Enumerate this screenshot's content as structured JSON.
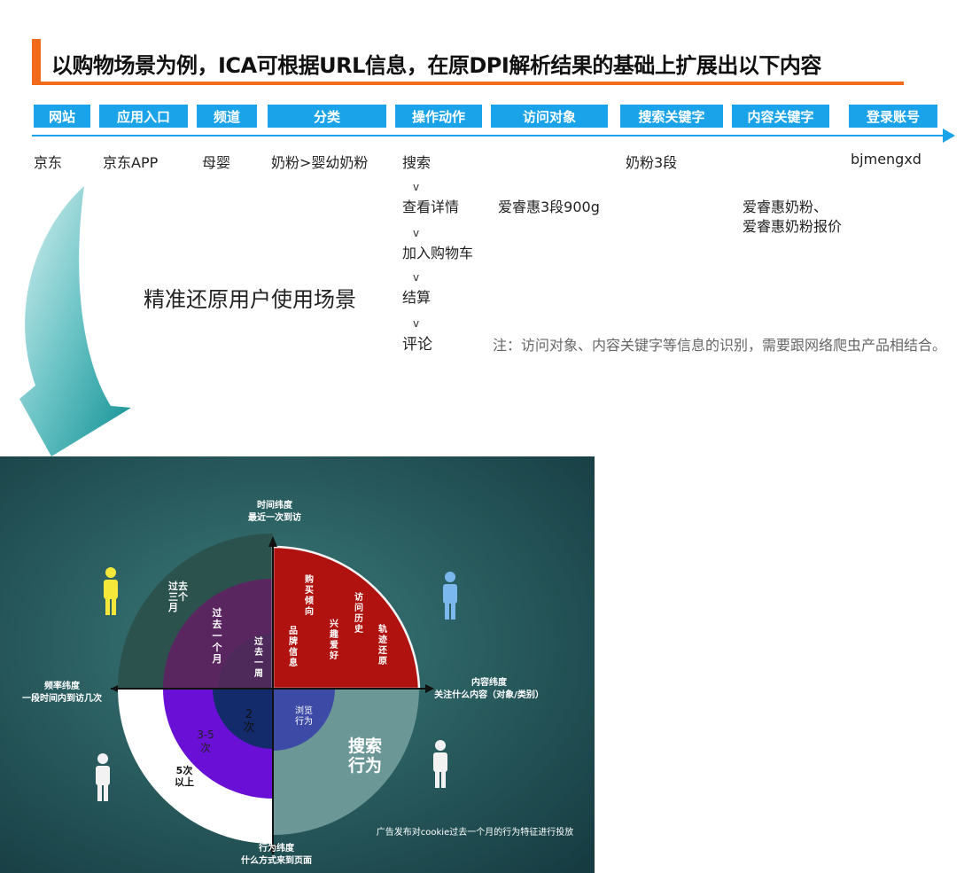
{
  "title": "以购物场景为例，ICA可根据URL信息，在原DPI解析结果的基础上扩展出以下内容",
  "headers": [
    "网站",
    "应用入口",
    "频道",
    "分类",
    "操作动作",
    "访问对象",
    "搜索关键字",
    "内容关键字",
    "登录账号"
  ],
  "row": {
    "site": "京东",
    "app": "京东APP",
    "channel": "母婴",
    "category": "奶粉>婴幼奶粉",
    "search_keyword": "奶粉3段",
    "account": "bjmengxd",
    "object": "爱睿惠3段900g",
    "content_kw_1": "爱睿惠奶粉、",
    "content_kw_2": "爱睿惠奶粉报价"
  },
  "actions": [
    "搜索",
    "查看详情",
    "加入购物车",
    "结算",
    "评论"
  ],
  "arrow_glyph": "v",
  "scene_label": "精准还原用户使用场景",
  "note": "注：访问对象、内容关键字等信息的识别，需要跟网络爬虫产品相结合。",
  "diagram": {
    "top_axis": [
      "时间纬度",
      "最近一次到访"
    ],
    "left_axis": [
      "频率纬度",
      "一段时间内到访几次"
    ],
    "right_axis": [
      "内容纬度",
      "关注什么内容（对象/类别）"
    ],
    "bottom_axis": [
      "行为纬度",
      "什么方式来到页面"
    ],
    "time_outer": "过去三个月",
    "time_mid": "过去一个月",
    "time_inner": "过去一周",
    "content_cols": [
      "购买倾向",
      "访问历史",
      "品牌信息",
      "兴趣爱好",
      "轨迹还原"
    ],
    "freq_inner": "2次",
    "freq_mid": "3-5次",
    "freq_outer": "5次以上",
    "browse": "浏览行为",
    "search": "搜索行为",
    "caption": "广告发布对cookie过去一个月的行为特征进行投放"
  },
  "colors": {
    "accent_orange": "#f26b1d",
    "header_blue": "#1aa3e8",
    "panel_bg": "#1f5a5c",
    "red": "#b0120f",
    "purple": "#6a1fcf",
    "plum": "#5a2660"
  }
}
